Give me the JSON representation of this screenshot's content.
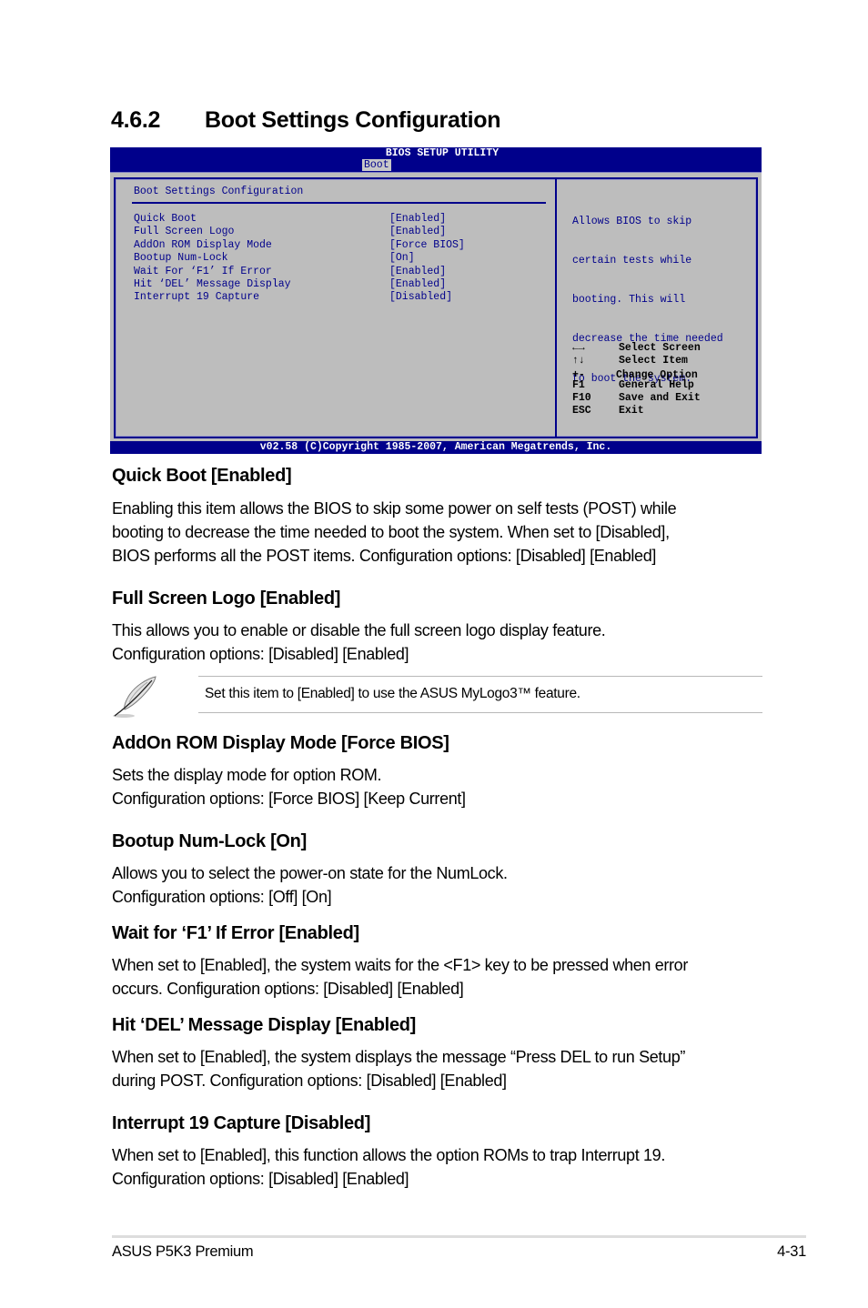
{
  "section": {
    "number": "4.6.2",
    "title": "Boot Settings Configuration"
  },
  "bios": {
    "utility_title": "BIOS SETUP UTILITY",
    "active_tab": "Boot",
    "panel_title": "Boot Settings Configuration",
    "items": [
      {
        "label": "Quick Boot",
        "value": "[Enabled]"
      },
      {
        "label": "Full Screen Logo",
        "value": "[Enabled]"
      },
      {
        "label": "AddOn ROM Display Mode",
        "value": "[Force BIOS]"
      },
      {
        "label": "Bootup Num-Lock",
        "value": "[On]"
      },
      {
        "label": "Wait For ‘F1’ If Error",
        "value": "[Enabled]"
      },
      {
        "label": "Hit ‘DEL’ Message Display",
        "value": "[Enabled]"
      },
      {
        "label": "Interrupt 19 Capture",
        "value": "[Disabled]"
      }
    ],
    "help_lines": [
      "Allows BIOS to skip",
      "certain tests while",
      "booting. This will",
      "decrease the time needed",
      "to boot the system."
    ],
    "keys": [
      {
        "key": "←→",
        "icon": "left-right-arrows-icon",
        "action": "Select Screen"
      },
      {
        "key": "↑↓",
        "icon": "up-down-arrows-icon",
        "action": "Select Item"
      },
      {
        "key": "+-",
        "icon": "plus-minus-icon",
        "action": "Change Option"
      },
      {
        "key": "F1",
        "action": "General Help"
      },
      {
        "key": "F10",
        "action": "Save and Exit"
      },
      {
        "key": "ESC",
        "action": "Exit"
      }
    ],
    "footer": "v02.58 (C)Copyright 1985-2007, American Megatrends, Inc.",
    "colors": {
      "frame_blue": "#00008b",
      "panel_gray": "#bdbdbd",
      "text_blue": "#00008b"
    }
  },
  "sections": [
    {
      "heading": "Quick Boot [Enabled]",
      "lines": [
        "Enabling this item allows the BIOS to skip some power on self tests (POST) while",
        "booting to decrease the time needed to boot the system. When set to [Disabled],",
        "BIOS performs all the POST items. Configuration options: [Disabled] [Enabled]"
      ]
    },
    {
      "heading": "Full Screen Logo [Enabled]",
      "lines": [
        "This allows you to enable or disable the full screen logo display feature.",
        "Configuration options: [Disabled] [Enabled]"
      ]
    },
    {
      "heading": "AddOn ROM Display Mode [Force BIOS]",
      "lines": [
        "Sets the display mode for option ROM.",
        "Configuration options: [Force BIOS] [Keep Current]"
      ]
    },
    {
      "heading": "Bootup Num-Lock [On]",
      "lines": [
        "Allows you to select the power-on state for the NumLock.",
        "Configuration options: [Off] [On]"
      ]
    },
    {
      "heading": "Wait for ‘F1’ If Error [Enabled]",
      "lines": [
        "When set to [Enabled], the system waits for the <F1> key to be pressed when error",
        "occurs. Configuration options: [Disabled] [Enabled]"
      ]
    },
    {
      "heading": "Hit ‘DEL’ Message Display [Enabled]",
      "lines": [
        "When set to [Enabled], the system displays the message “Press DEL to run Setup”",
        "during POST. Configuration options: [Disabled] [Enabled]"
      ]
    },
    {
      "heading": "Interrupt 19 Capture [Disabled]",
      "lines": [
        "When set to [Enabled], this function allows the option ROMs to trap Interrupt 19.",
        "Configuration options: [Disabled] [Enabled]"
      ]
    }
  ],
  "note": {
    "icon": "feather-pen-icon",
    "text": "Set this item to [Enabled] to use the ASUS MyLogo3™ feature."
  },
  "footer": {
    "product": "ASUS P5K3 Premium",
    "page": "4-31"
  }
}
